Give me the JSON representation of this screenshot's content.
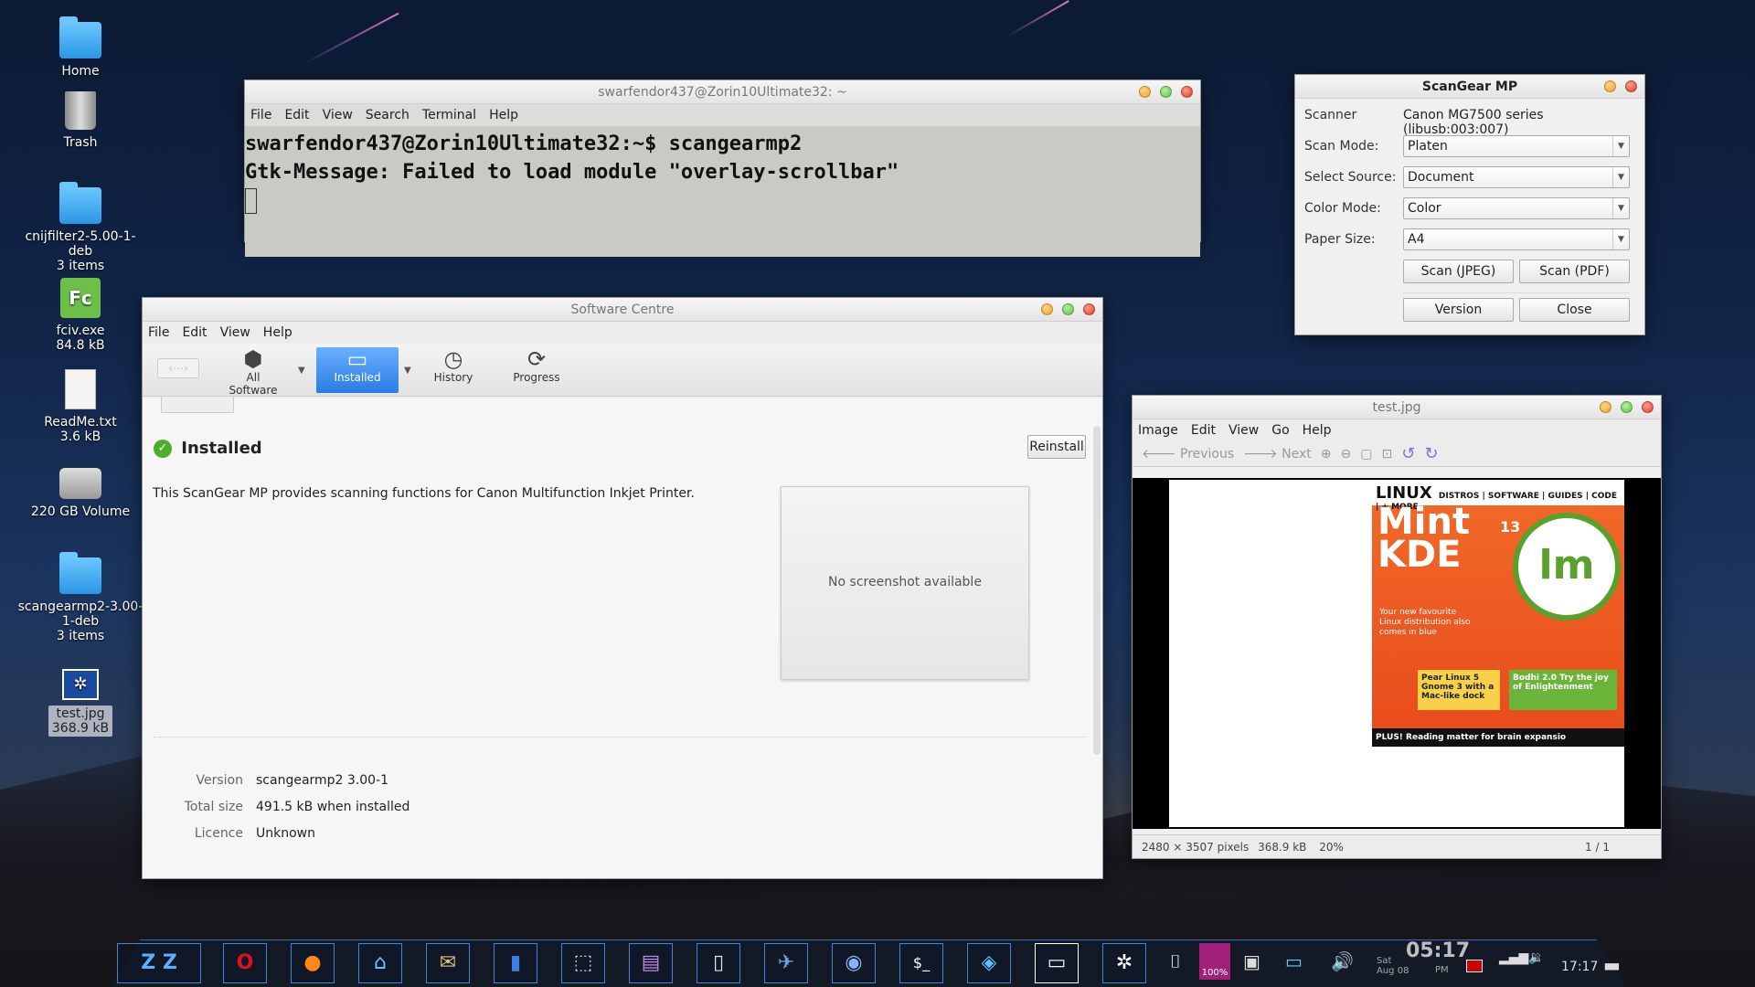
{
  "desktop": {
    "icons": [
      {
        "label": "Home",
        "sub": "",
        "icon": "home-folder-icon"
      },
      {
        "label": "Trash",
        "sub": "",
        "icon": "trash-icon"
      },
      {
        "label": "cnijfilter2-5.00-1-deb",
        "sub": "3 items",
        "icon": "folder-icon"
      },
      {
        "label": "fciv.exe",
        "sub": "84.8 kB",
        "icon": "exe-icon",
        "glyph": "Fc"
      },
      {
        "label": "ReadMe.txt",
        "sub": "3.6 kB",
        "icon": "text-file-icon"
      },
      {
        "label": "220 GB Volume",
        "sub": "",
        "icon": "drive-icon"
      },
      {
        "label": "scangearmp2-3.00-1-deb",
        "sub": "3 items",
        "icon": "folder-icon"
      },
      {
        "label": "test.jpg",
        "sub": "368.9 kB",
        "icon": "image-file-icon"
      }
    ]
  },
  "terminal": {
    "title": "swarfendor437@Zorin10Ultimate32: ~",
    "menu": [
      "File",
      "Edit",
      "View",
      "Search",
      "Terminal",
      "Help"
    ],
    "lines": [
      "swarfendor437@Zorin10Ultimate32:~$ scangearmp2",
      "Gtk-Message: Failed to load module \"overlay-scrollbar\""
    ]
  },
  "scangear": {
    "title": "ScanGear MP",
    "scanner_label": "Scanner",
    "scanner_value": "Canon MG7500 series (libusb:003:007)",
    "scan_mode_label": "Scan Mode:",
    "scan_mode_value": "Platen",
    "source_label": "Select Source:",
    "source_value": "Document",
    "color_label": "Color Mode:",
    "color_value": "Color",
    "paper_label": "Paper Size:",
    "paper_value": "A4",
    "scan_jpeg": "Scan (JPEG)",
    "scan_pdf": "Scan (PDF)",
    "version": "Version",
    "close": "Close"
  },
  "software_centre": {
    "title": "Software Centre",
    "menu": [
      "File",
      "Edit",
      "View",
      "Help"
    ],
    "toolbar": {
      "all_software": "All Software",
      "installed": "Installed",
      "history": "History",
      "progress": "Progress"
    },
    "status": "Installed",
    "reinstall": "Reinstall",
    "description": "This ScanGear MP provides scanning functions for Canon Multifunction Inkjet Printer.",
    "no_screenshot": "No screenshot available",
    "meta": {
      "version_key": "Version",
      "version_val": "scangearmp2 3.00-1",
      "size_key": "Total size",
      "size_val": "491.5 kB when installed",
      "licence_key": "Licence",
      "licence_val": "Unknown"
    }
  },
  "image_viewer": {
    "title": "test.jpg",
    "menu": [
      "Image",
      "Edit",
      "View",
      "Go",
      "Help"
    ],
    "previous": "Previous",
    "next": "Next",
    "status_dims": "2480 × 3507 pixels",
    "status_size": "368.9 kB",
    "status_zoom": "20%",
    "status_page": "1 / 1",
    "magazine": {
      "brand": "LINUX",
      "tagline": "DISTROS | SOFTWARE | GUIDES | CODE | + MORE",
      "title1": "Mint",
      "title2": "KDE",
      "issue": "13",
      "blurb": "Your new favourite Linux distribution also comes in blue",
      "box1": "Pear Linux 5 Gnome 3 with a Mac-like dock",
      "box2": "Bodhi 2.0 Try the joy of Enlightenment",
      "bottom": "PLUS! Reading matter for brain expansio"
    }
  },
  "taskbar": {
    "clock_big": "05:17",
    "day": "Sat",
    "date": "Aug 08",
    "ampm": "PM",
    "tray_time": "17:17",
    "volume_badge": "100%"
  }
}
